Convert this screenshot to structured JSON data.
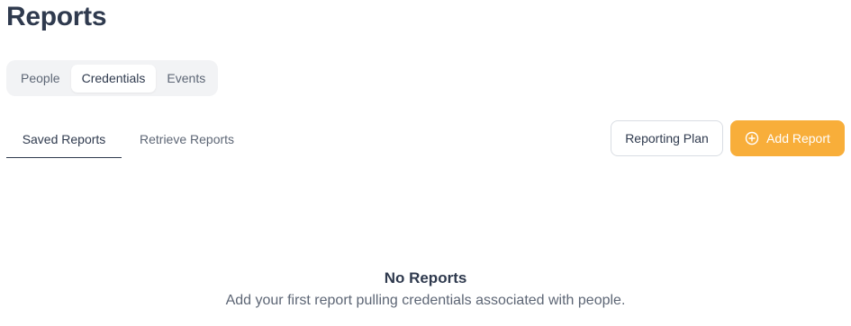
{
  "header": {
    "title": "Reports"
  },
  "segmented_tabs": [
    {
      "label": "People",
      "active": false
    },
    {
      "label": "Credentials",
      "active": true
    },
    {
      "label": "Events",
      "active": false
    }
  ],
  "subtabs": [
    {
      "label": "Saved Reports",
      "active": true
    },
    {
      "label": "Retrieve Reports",
      "active": false
    }
  ],
  "actions": {
    "reporting_plan_label": "Reporting Plan",
    "add_report_label": "Add Report",
    "add_report_icon": "plus-circle-icon"
  },
  "empty_state": {
    "title": "No Reports",
    "message": "Add your first report pulling credentials associated with people."
  },
  "colors": {
    "accent": "#f8ae3a",
    "text_dark": "#2f3a4e",
    "text_muted": "#5d6675",
    "segment_bg": "#f2f3f5"
  }
}
